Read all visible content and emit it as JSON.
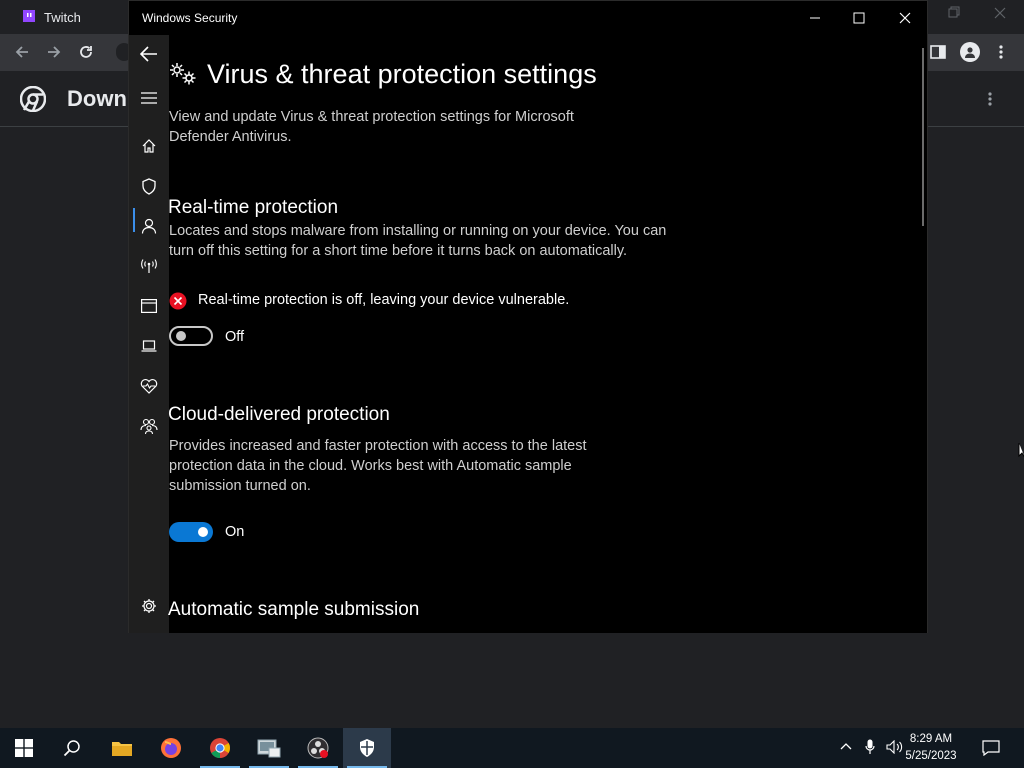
{
  "chrome": {
    "tab_title": "Twitch",
    "page_title": "Downl"
  },
  "security": {
    "window_title": "Windows Security",
    "page_title": "Virus & threat protection settings",
    "page_desc": "View and update Virus & threat protection settings for Microsoft Defender Antivirus.",
    "sections": {
      "realtime": {
        "title": "Real-time protection",
        "desc": "Locates and stops malware from installing or running on your device. You can turn off this setting for a short time before it turns back on automatically.",
        "warning": "Real-time protection is off, leaving your device vulnerable.",
        "toggle_label": "Off"
      },
      "cloud": {
        "title": "Cloud-delivered protection",
        "desc": "Provides increased and faster protection with access to the latest protection data in the cloud. Works best with Automatic sample submission turned on.",
        "toggle_label": "On"
      },
      "sample": {
        "title": "Automatic sample submission"
      }
    },
    "sidebar": [
      "home-icon",
      "shield-icon",
      "account-icon",
      "network-icon",
      "app-browser-icon",
      "device-icon",
      "health-icon",
      "family-icon",
      "settings-icon"
    ]
  },
  "taskbar": {
    "time": "8:29 AM",
    "date": "5/25/2023"
  },
  "colors": {
    "accent": "#0a78d4",
    "error": "#e81123"
  }
}
